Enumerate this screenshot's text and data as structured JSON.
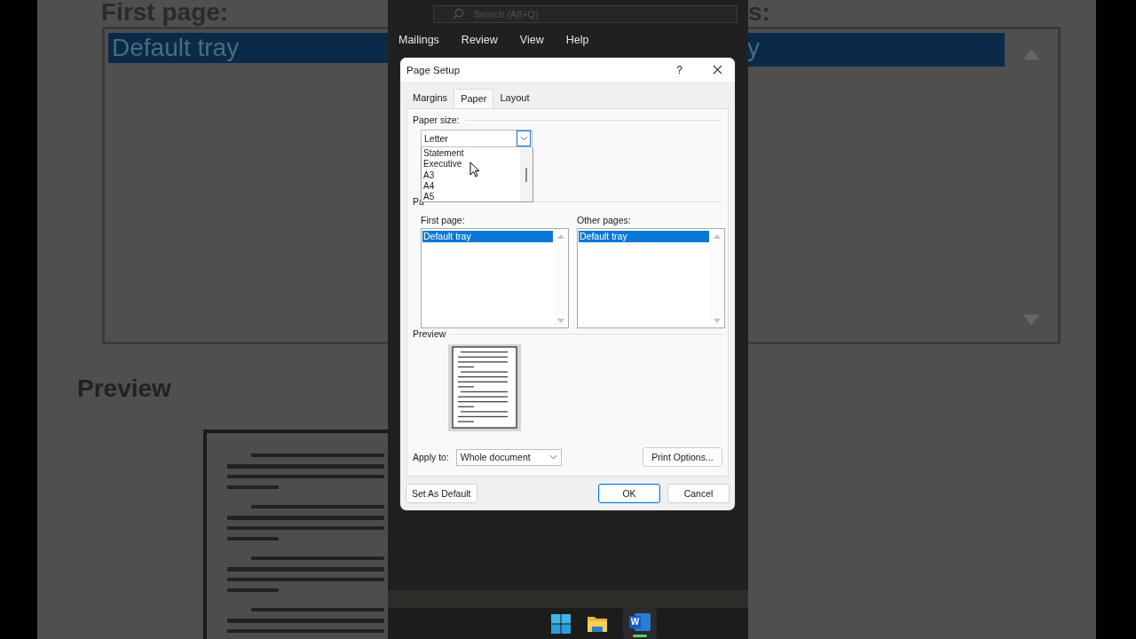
{
  "backdrop_left": {
    "heading": "First page:",
    "list_item": {
      "label": "Default tray",
      "selected": true
    },
    "section": "Preview"
  },
  "backdrop_right": {
    "heading": "s:",
    "list_item": {
      "label": "y",
      "selected": true
    }
  },
  "search": {
    "placeholder": "Search (Alt+Q)"
  },
  "ribbon_tabs": [
    "Mailings",
    "Review",
    "View",
    "Help"
  ],
  "dialog": {
    "title": "Page Setup",
    "help": "?",
    "tabs": [
      {
        "label": "Margins",
        "selected": false
      },
      {
        "label": "Paper",
        "selected": true
      },
      {
        "label": "Layout",
        "selected": false
      }
    ],
    "paper_size": {
      "label": "Paper size:",
      "value": "Letter",
      "expanded": true,
      "options": [
        "Statement",
        "Executive",
        "A3",
        "A4",
        "A5"
      ]
    },
    "paper_source": {
      "label": "Pa",
      "first_page": {
        "label": "First page:",
        "items": [
          {
            "label": "Default tray",
            "selected": true
          }
        ]
      },
      "other_pages": {
        "label": "Other pages:",
        "items": [
          {
            "label": "Default tray",
            "selected": true
          }
        ]
      }
    },
    "preview": {
      "label": "Preview"
    },
    "apply_to": {
      "label": "Apply to:",
      "value": "Whole document"
    },
    "print_options": "Print Options...",
    "set_default": "Set As Default",
    "ok": "OK",
    "cancel": "Cancel"
  },
  "taskbar_apps": [
    {
      "kind": "start"
    },
    {
      "kind": "folder"
    },
    {
      "kind": "word",
      "letter": "W",
      "running": true
    }
  ]
}
